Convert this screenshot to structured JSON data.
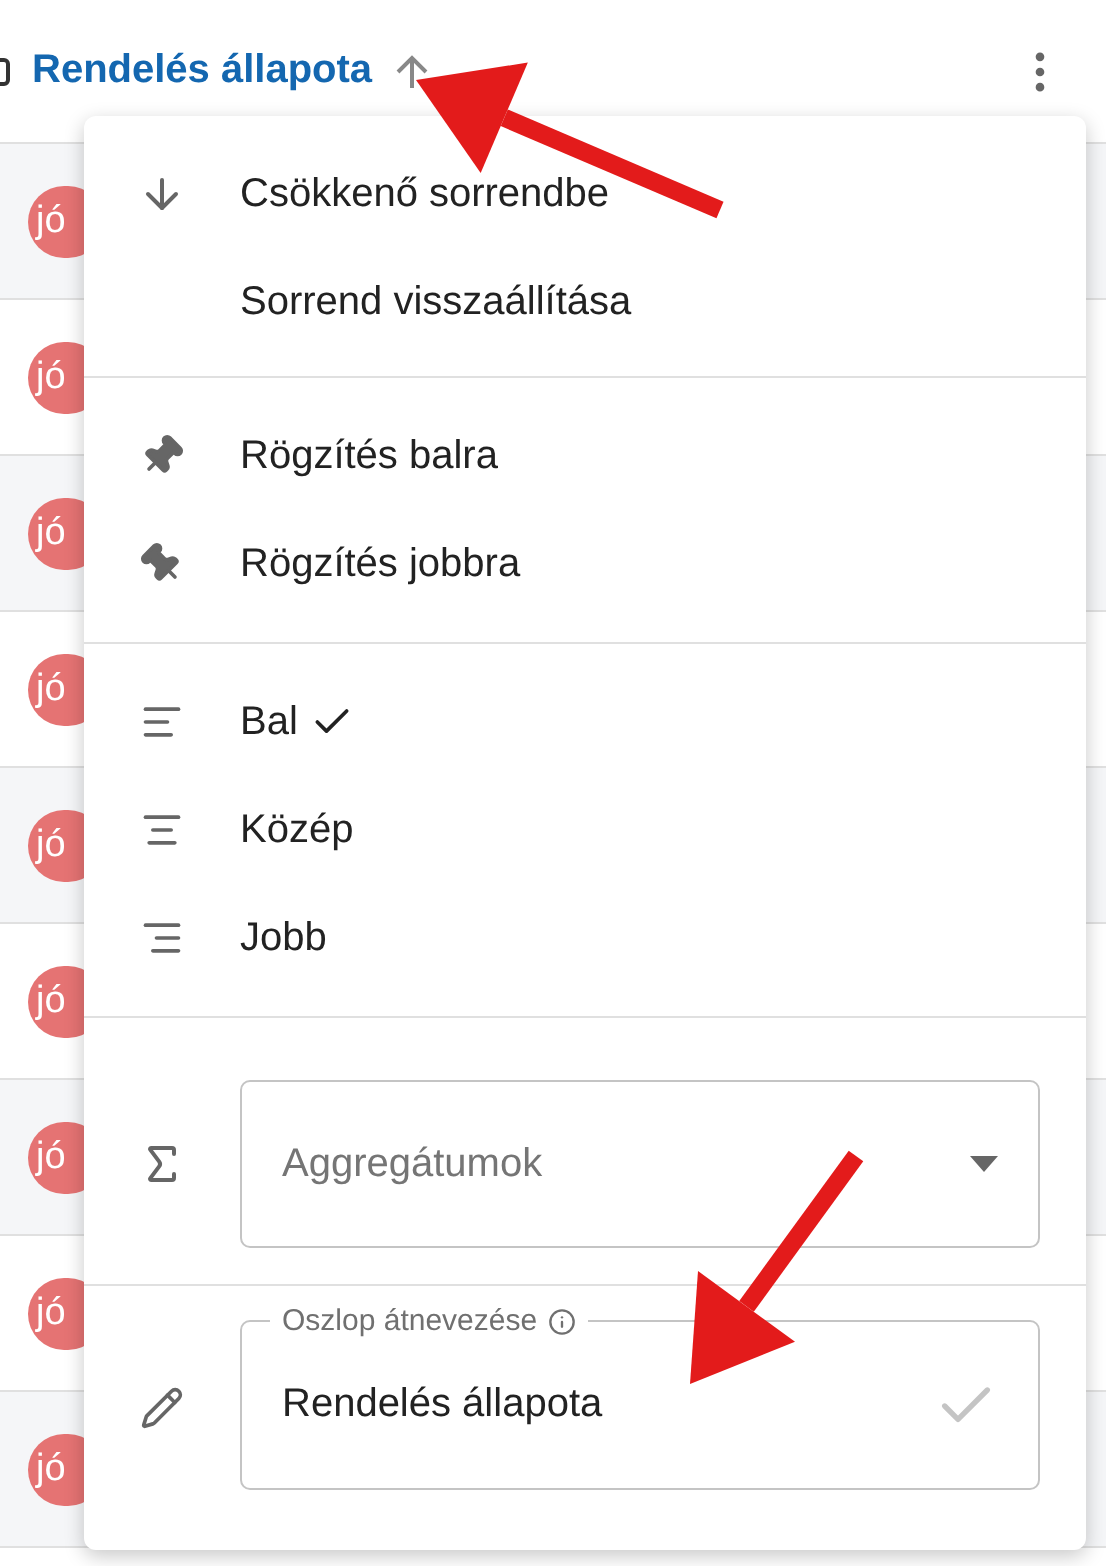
{
  "header": {
    "title": "Rendelés állapota"
  },
  "rows": [
    {
      "badge": "jó"
    },
    {
      "badge": "jó"
    },
    {
      "badge": "jó"
    },
    {
      "badge": "jó"
    },
    {
      "badge": "jó"
    },
    {
      "badge": "jó"
    },
    {
      "badge": "jó"
    },
    {
      "badge": "jó"
    },
    {
      "badge": "jó"
    }
  ],
  "menu": {
    "sort": [
      {
        "label": "Csökkenő sorrendbe"
      },
      {
        "label": "Sorrend visszaállítása"
      }
    ],
    "pin": [
      {
        "label": "Rögzítés balra"
      },
      {
        "label": "Rögzítés jobbra"
      }
    ],
    "align": [
      {
        "label": "Bal",
        "selected": true
      },
      {
        "label": "Közép",
        "selected": false
      },
      {
        "label": "Jobb",
        "selected": false
      }
    ],
    "aggregate": {
      "placeholder": "Aggregátumok"
    },
    "rename": {
      "label": "Oszlop átnevezése",
      "value": "Rendelés állapota"
    }
  }
}
